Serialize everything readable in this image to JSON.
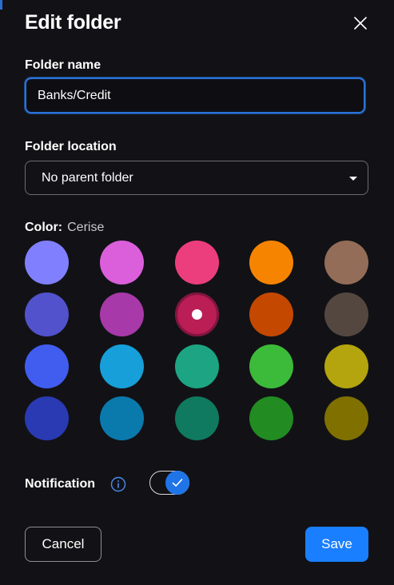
{
  "dialog": {
    "title": "Edit folder"
  },
  "folder_name": {
    "label": "Folder name",
    "value": "Banks/Credit"
  },
  "folder_location": {
    "label": "Folder location",
    "selected": "No parent folder"
  },
  "color": {
    "label": "Color:",
    "selected_name": "Cerise",
    "selected_index": 7,
    "swatches": [
      "#8080ff",
      "#db5fdb",
      "#ec3e7c",
      "#f78400",
      "#936d58",
      "#5252cc",
      "#a839a8",
      "#ba1e55",
      "#c44800",
      "#54473f",
      "#415df0",
      "#179fd9",
      "#1da583",
      "#3cbb3a",
      "#b4a40e",
      "#2a3ab3",
      "#0a7aad",
      "#0f7a5f",
      "#228b22",
      "#807000"
    ]
  },
  "notification": {
    "label": "Notification",
    "enabled": true
  },
  "actions": {
    "cancel_label": "Cancel",
    "save_label": "Save"
  },
  "icons": {
    "close": "close-icon",
    "info": "info-icon",
    "caret": "caret-down-icon",
    "check": "check-icon"
  }
}
